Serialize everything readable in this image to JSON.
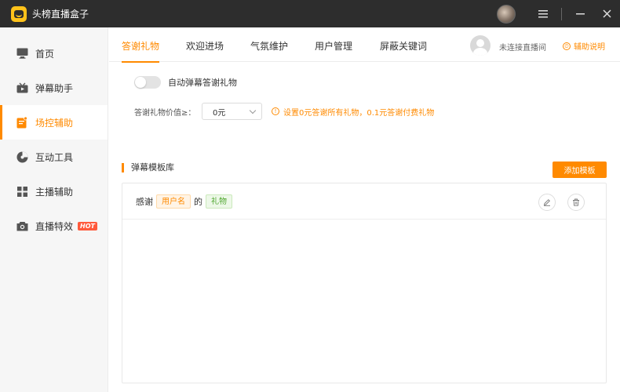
{
  "app": {
    "title": "头榜直播盒子"
  },
  "sidebar": {
    "items": [
      {
        "label": "首页",
        "icon": "monitor-icon"
      },
      {
        "label": "弹幕助手",
        "icon": "tv-icon"
      },
      {
        "label": "场控辅助",
        "icon": "clipboard-icon",
        "active": true
      },
      {
        "label": "互动工具",
        "icon": "pie-icon"
      },
      {
        "label": "主播辅助",
        "icon": "grid-icon"
      },
      {
        "label": "直播特效",
        "icon": "camera-icon",
        "badge": "HOT"
      }
    ]
  },
  "tabs": [
    {
      "label": "答谢礼物",
      "active": true
    },
    {
      "label": "欢迎进场"
    },
    {
      "label": "气氛维护"
    },
    {
      "label": "用户管理"
    },
    {
      "label": "屏蔽关键词"
    }
  ],
  "header": {
    "live_status": "未连接直播间",
    "help_label": "辅助说明"
  },
  "settings": {
    "auto_thanks_label": "自动弹幕答谢礼物",
    "auto_thanks_enabled": false,
    "gift_value_label": "答谢礼物价值≥：",
    "gift_value": "0元",
    "tip": "设置0元答谢所有礼物，0.1元答谢付费礼物"
  },
  "templates": {
    "section_title": "弹幕模板库",
    "add_label": "添加模板",
    "rows": [
      {
        "prefix": "感谢",
        "user_chip": "用户名",
        "middle": "的",
        "gift_chip": "礼物"
      }
    ]
  },
  "colors": {
    "accent": "#ff8a00",
    "titlebar": "#2d2d2d",
    "hot": "#ff5a3c"
  }
}
